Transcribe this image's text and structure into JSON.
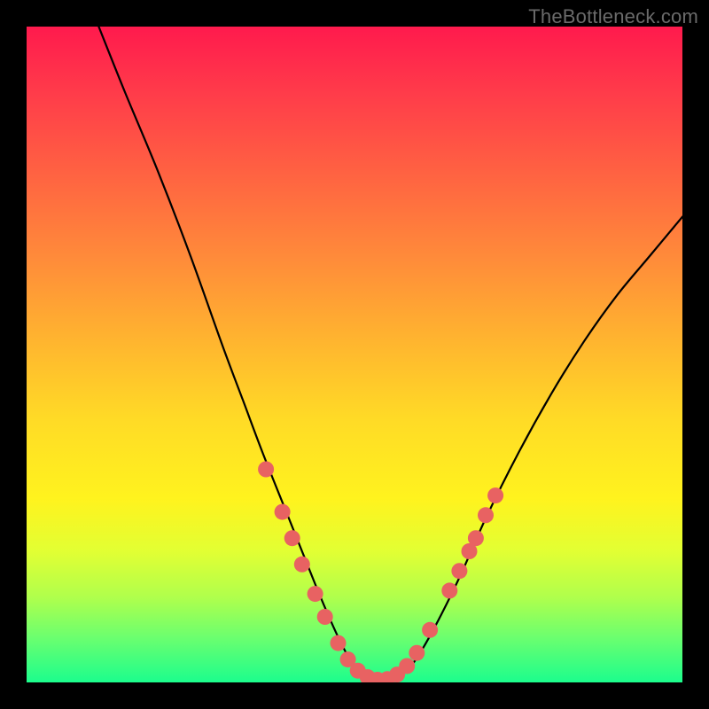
{
  "watermark": "TheBottleneck.com",
  "chart_data": {
    "type": "line",
    "title": "",
    "xlabel": "",
    "ylabel": "",
    "xlim": [
      0,
      100
    ],
    "ylim": [
      0,
      100
    ],
    "grid": false,
    "legend": false,
    "series": [
      {
        "name": "curve",
        "x": [
          11,
          15,
          20,
          25,
          30,
          33,
          36,
          40,
          44,
          47,
          49,
          51,
          53,
          55,
          57,
          59,
          62,
          66,
          70,
          75,
          80,
          85,
          90,
          95,
          100
        ],
        "y": [
          100,
          90,
          78,
          65,
          51,
          43,
          35,
          25,
          15,
          8,
          4,
          1,
          0,
          0,
          1,
          3,
          8,
          16,
          25,
          35,
          44,
          52,
          59,
          65,
          71
        ]
      }
    ],
    "markers": {
      "name": "highlight-dots",
      "color": "#e86262",
      "points": [
        {
          "x": 36.5,
          "y": 32.5
        },
        {
          "x": 39.0,
          "y": 26.0
        },
        {
          "x": 40.5,
          "y": 22.0
        },
        {
          "x": 42.0,
          "y": 18.0
        },
        {
          "x": 44.0,
          "y": 13.5
        },
        {
          "x": 45.5,
          "y": 10.0
        },
        {
          "x": 47.5,
          "y": 6.0
        },
        {
          "x": 49.0,
          "y": 3.5
        },
        {
          "x": 50.5,
          "y": 1.8
        },
        {
          "x": 52.0,
          "y": 0.8
        },
        {
          "x": 53.5,
          "y": 0.4
        },
        {
          "x": 55.0,
          "y": 0.5
        },
        {
          "x": 56.5,
          "y": 1.2
        },
        {
          "x": 58.0,
          "y": 2.5
        },
        {
          "x": 59.5,
          "y": 4.5
        },
        {
          "x": 61.5,
          "y": 8.0
        },
        {
          "x": 64.5,
          "y": 14.0
        },
        {
          "x": 66.0,
          "y": 17.0
        },
        {
          "x": 67.5,
          "y": 20.0
        },
        {
          "x": 68.5,
          "y": 22.0
        },
        {
          "x": 70.0,
          "y": 25.5
        },
        {
          "x": 71.5,
          "y": 28.5
        }
      ]
    }
  }
}
